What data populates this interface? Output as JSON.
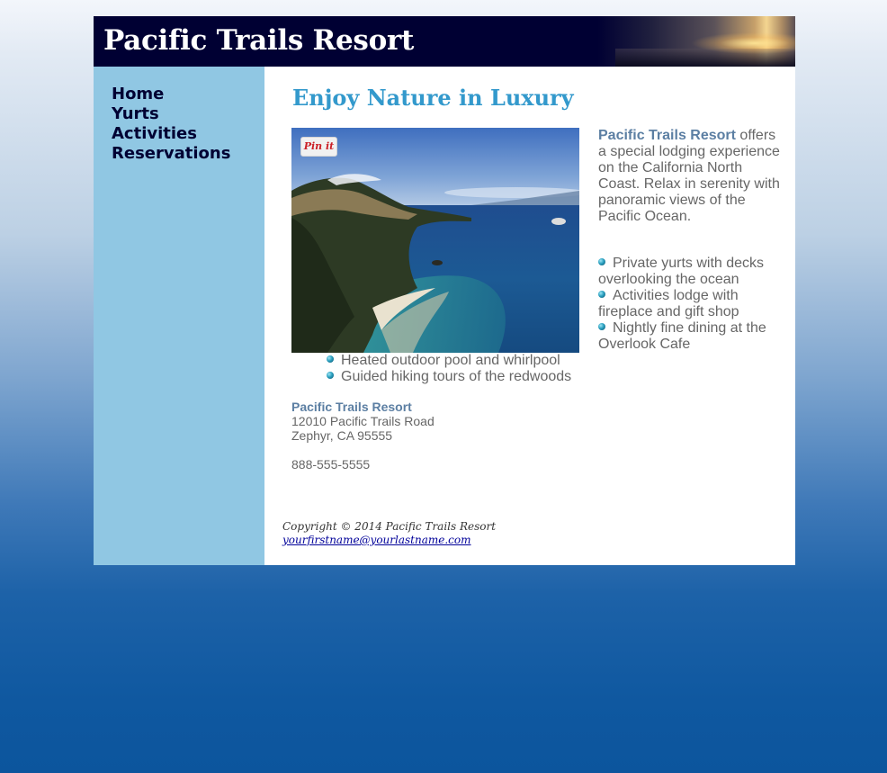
{
  "header": {
    "title": "Pacific Trails Resort"
  },
  "nav": {
    "items": [
      {
        "label": "Home"
      },
      {
        "label": "Yurts"
      },
      {
        "label": "Activities"
      },
      {
        "label": "Reservations"
      }
    ]
  },
  "main": {
    "heading": "Enjoy Nature in Luxury",
    "pin_button": "Pin it",
    "intro": {
      "name": "Pacific Trails Resort",
      "text": " offers a special lodging experience on the California North Coast. Relax in serenity with panoramic views of the Pacific Ocean."
    },
    "amenities": [
      "Private yurts with decks overlooking the ocean",
      "Activities lodge with fireplace and gift shop",
      "Nightly fine dining at the Overlook Cafe",
      "Heated outdoor pool and whirlpool",
      "Guided hiking tours of the redwoods"
    ],
    "contact": {
      "name": "Pacific Trails Resort",
      "street": "12010 Pacific Trails Road",
      "city": "Zephyr, CA 95555",
      "phone": "888-555-5555"
    }
  },
  "footer": {
    "copyright": "Copyright © 2014 Pacific Trails Resort",
    "email": "yourfirstname@yourlastname.com"
  },
  "colors": {
    "header_bg": "#000033",
    "nav_bg": "#90c7e3",
    "heading": "#3399cc",
    "accent_text": "#5c7fa3",
    "body_text": "#666666",
    "link": "#000099"
  }
}
